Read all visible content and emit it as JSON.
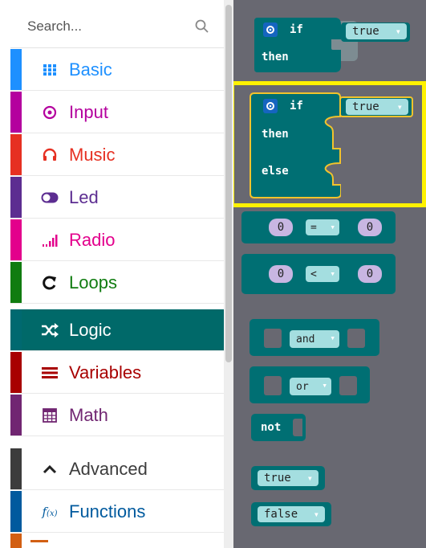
{
  "search": {
    "placeholder": "Search..."
  },
  "categories": [
    {
      "label": "Basic",
      "icon": "grid-icon",
      "color": "#1e90ff"
    },
    {
      "label": "Input",
      "icon": "target-icon",
      "color": "#b4009e"
    },
    {
      "label": "Music",
      "icon": "headphones-icon",
      "color": "#e63022"
    },
    {
      "label": "Led",
      "icon": "toggle-icon",
      "color": "#5c2d91"
    },
    {
      "label": "Radio",
      "icon": "signal-bars-icon",
      "color": "#e3008c"
    },
    {
      "label": "Loops",
      "icon": "refresh-icon",
      "color": "#107c10"
    },
    {
      "label": "Logic",
      "icon": "shuffle-icon",
      "color": "#006970"
    },
    {
      "label": "Variables",
      "icon": "list-lines-icon",
      "color": "#a80000"
    },
    {
      "label": "Math",
      "icon": "calculator-icon",
      "color": "#712672"
    },
    {
      "label": "Advanced",
      "icon": "chevron-up-icon",
      "color": "#3c3c3c"
    },
    {
      "label": "Functions",
      "icon": "function-icon",
      "color": "#005a9e"
    }
  ],
  "blocks": {
    "if_kw": "if",
    "then_kw": "then",
    "else_kw": "else",
    "true_val": "true",
    "false_val": "false",
    "zero": "0",
    "eq_op": "=",
    "lt_op": "<",
    "and_op": "and",
    "or_op": "or",
    "not_kw": "not"
  }
}
